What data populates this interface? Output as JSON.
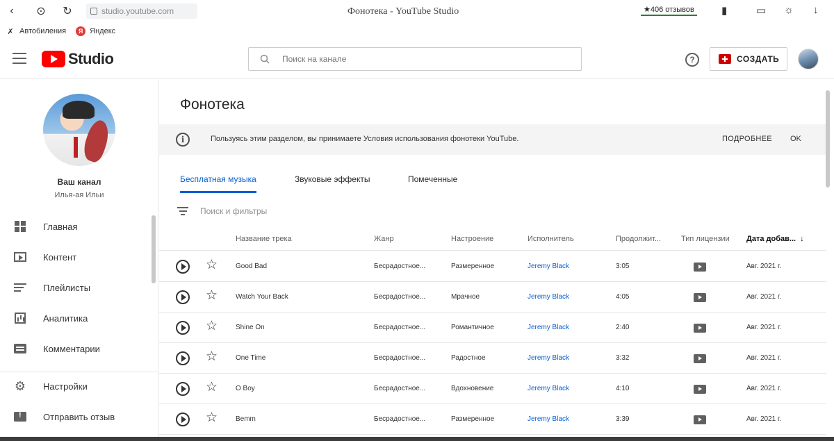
{
  "browser": {
    "url": "studio.youtube.com",
    "tab_title": "Фонотека - YouTube Studio",
    "reviews_badge": "★406 отзывов",
    "bookmarks": [
      {
        "label": "Автобиления",
        "icon": "bookmark-x-icon"
      },
      {
        "label": "Яндекс",
        "icon": "yandex-icon"
      }
    ]
  },
  "header": {
    "logo_text": "Studio",
    "search_placeholder": "Поиск на канале",
    "create_label": "СОЗДАТЬ"
  },
  "sidebar": {
    "channel_name": "Ваш канал",
    "channel_subtitle": "Илья-ая Ильи",
    "items": [
      {
        "label": "Главная",
        "icon": "dashboard-icon"
      },
      {
        "label": "Контент",
        "icon": "content-icon"
      },
      {
        "label": "Плейлисты",
        "icon": "playlists-icon"
      },
      {
        "label": "Аналитика",
        "icon": "analytics-icon"
      },
      {
        "label": "Комментарии",
        "icon": "comments-icon"
      }
    ],
    "bottom_items": [
      {
        "label": "Настройки",
        "icon": "settings-icon"
      },
      {
        "label": "Отправить отзыв",
        "icon": "feedback-icon"
      }
    ]
  },
  "main": {
    "page_title": "Фонотека",
    "banner": {
      "text": "Пользуясь этим разделом, вы принимаете Условия использования фонотеки YouTube.",
      "more": "ПОДРОБНЕЕ",
      "ok": "OK"
    },
    "tabs": [
      {
        "label": "Бесплатная музыка",
        "active": true
      },
      {
        "label": "Звуковые эффекты",
        "active": false
      },
      {
        "label": "Помеченные",
        "active": false
      }
    ],
    "filter_placeholder": "Поиск и фильтры",
    "columns": [
      "Название трека",
      "Жанр",
      "Настроение",
      "Исполнитель",
      "Продолжит...",
      "Тип лицензии",
      "Дата добав..."
    ],
    "rows": [
      {
        "title": "Good Bad",
        "genre": "Бесрадостное...",
        "mood": "Размеренное",
        "artist": "Jeremy Black",
        "duration": "3:05",
        "date": "Авг. 2021 г."
      },
      {
        "title": "Watch Your Back",
        "genre": "Бесрадостное...",
        "mood": "Мрачное",
        "artist": "Jeremy Black",
        "duration": "4:05",
        "date": "Авг. 2021 г."
      },
      {
        "title": "Shine On",
        "genre": "Бесрадостное...",
        "mood": "Романтичное",
        "artist": "Jeremy Black",
        "duration": "2:40",
        "date": "Авг. 2021 г."
      },
      {
        "title": "One Time",
        "genre": "Бесрадостное...",
        "mood": "Радостное",
        "artist": "Jeremy Black",
        "duration": "3:32",
        "date": "Авг. 2021 г."
      },
      {
        "title": "O Boy",
        "genre": "Бесрадостное...",
        "mood": "Вдохновение",
        "artist": "Jeremy Black",
        "duration": "4:10",
        "date": "Авг. 2021 г."
      },
      {
        "title": "Bemm",
        "genre": "Бесрадостное...",
        "mood": "Размеренное",
        "artist": "Jeremy Black",
        "duration": "3:39",
        "date": "Авг. 2021 г."
      }
    ]
  },
  "colors": {
    "brand_red": "#ff0000",
    "link_blue": "#065fd4",
    "banner_bg": "#f4f4f4"
  }
}
